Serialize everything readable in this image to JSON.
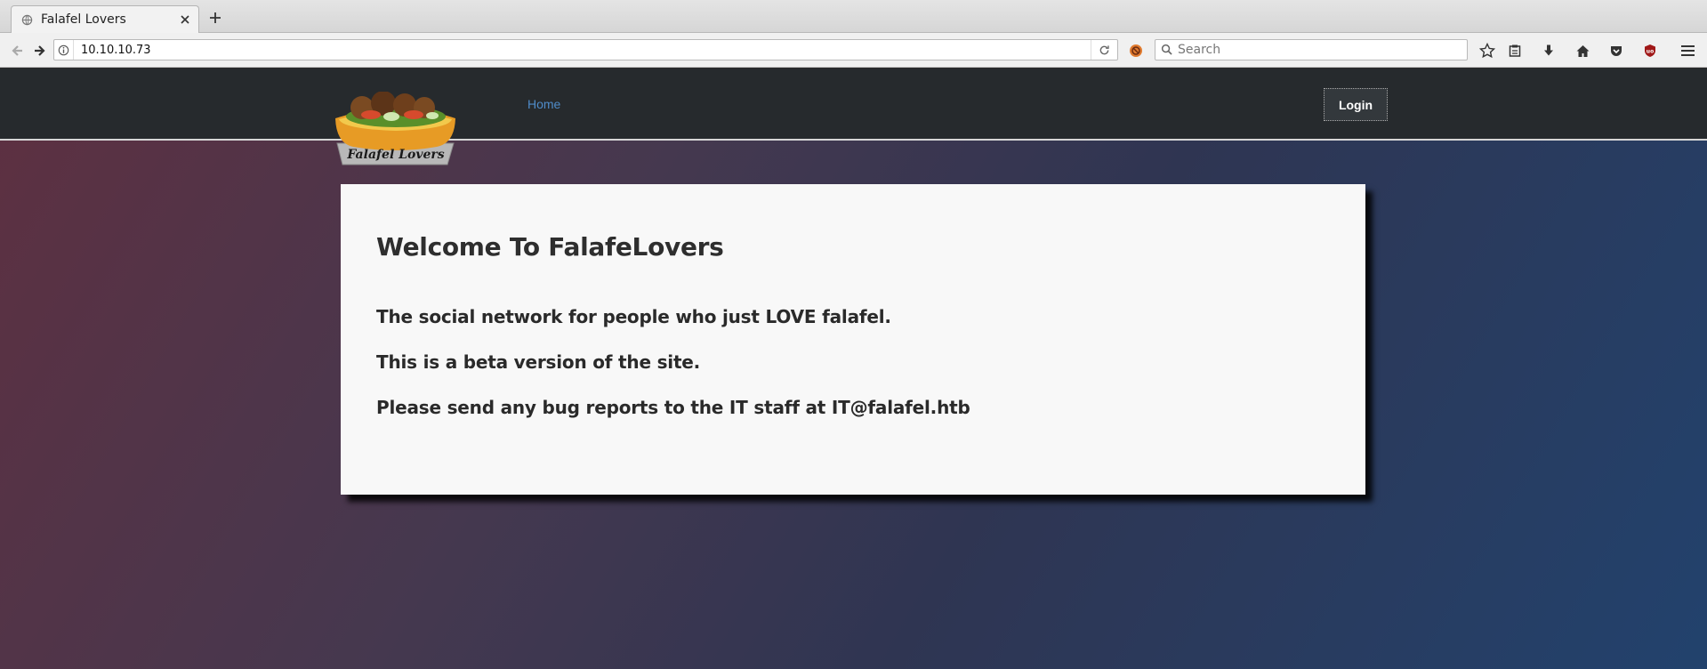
{
  "browser": {
    "tab": {
      "title": "Falafel Lovers"
    },
    "url": "10.10.10.73",
    "search": {
      "placeholder": "Search"
    }
  },
  "site": {
    "nav": {
      "home_label": "Home",
      "login_label": "Login"
    },
    "logo_text": "Falafel Lovers",
    "card": {
      "heading": "Welcome To FalafeLovers",
      "line1": "The social network for people who just LOVE falafel.",
      "line2": "This is a beta version of the site.",
      "line3": "Please send any bug reports to the IT staff at IT@falafel.htb"
    }
  },
  "icons": {
    "tab_favicon": "globe-icon",
    "tab_close": "close-icon",
    "new_tab": "plus-icon",
    "back": "back-arrow-icon",
    "forward": "forward-arrow-icon",
    "site_info": "info-icon",
    "reload": "reload-icon",
    "search": "search-icon",
    "bookmark": "star-icon",
    "reading_list": "clipboard-icon",
    "download": "download-icon",
    "home": "home-icon",
    "pocket": "pocket-icon",
    "ublock": "ublock-icon",
    "menu": "hamburger-menu-icon"
  },
  "colors": {
    "header_bg": "#262a2d",
    "link": "#4f8cc9",
    "card_bg": "#f8f8f8"
  }
}
